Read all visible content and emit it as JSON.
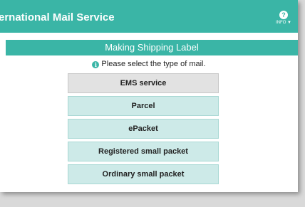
{
  "header": {
    "title": "ernational Mail Service",
    "info_icon": "?",
    "info_label": "INFO ▼"
  },
  "section": {
    "title": "Making Shipping Label"
  },
  "prompt": {
    "icon": "i",
    "text": "Please select the type of mail."
  },
  "options": [
    {
      "label": "EMS service",
      "selected": true
    },
    {
      "label": "Parcel",
      "selected": false
    },
    {
      "label": "ePacket",
      "selected": false
    },
    {
      "label": "Registered small packet",
      "selected": false
    },
    {
      "label": "Ordinary small packet",
      "selected": false
    }
  ],
  "colors": {
    "accent": "#3ab5a6",
    "option_bg": "#cdeae8",
    "option_selected_bg": "#e2e2e2"
  }
}
